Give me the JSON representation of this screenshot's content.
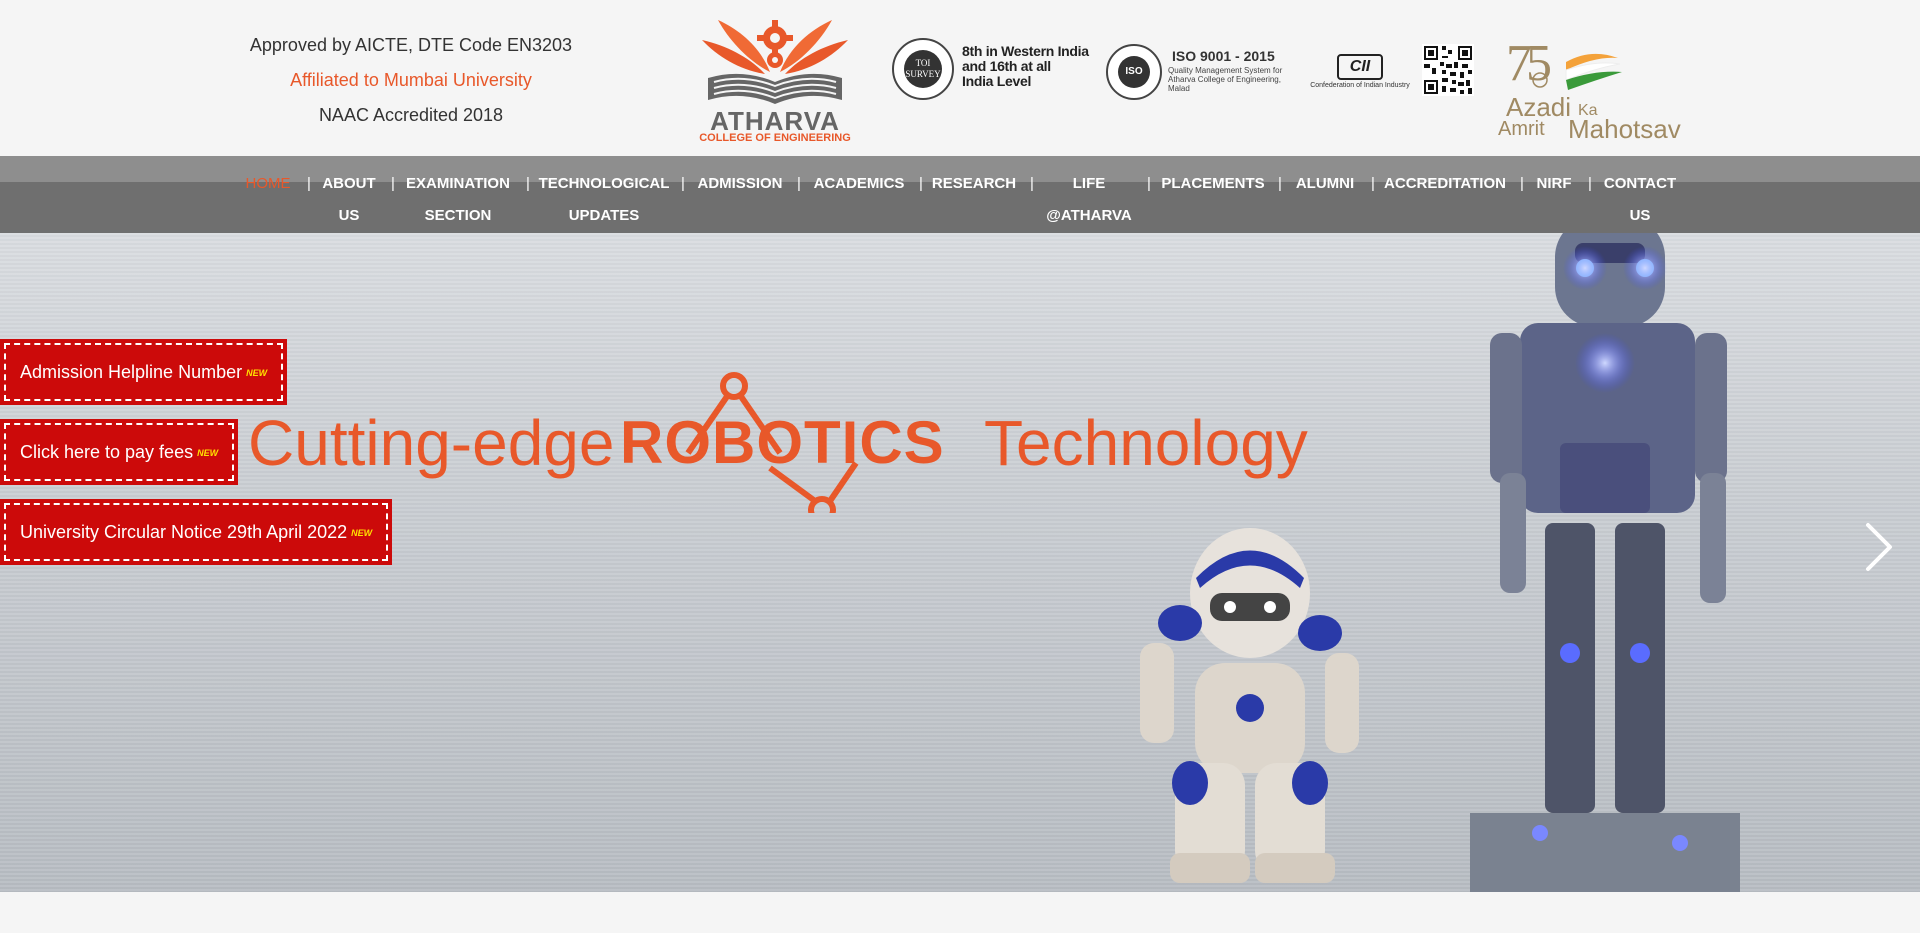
{
  "header": {
    "approval": "Approved by AICTE, DTE Code EN3203",
    "affiliation": "Affiliated to Mumbai University",
    "naac": "NAAC Accredited 2018",
    "logo_name": "ATHARVA",
    "logo_sub": "COLLEGE OF ENGINEERING",
    "toi_badge": "TOI SURVEY",
    "ranking_line1": "8th in Western India",
    "ranking_line2": "and 16th at all",
    "ranking_line3": "India Level",
    "iso_badge": "ISO",
    "iso_title": "ISO 9001 - 2015",
    "iso_desc": "Quality Management System for Atharva College of Engineering, Malad",
    "cii_mark": "CII",
    "cii_caption": "Confederation of Indian Industry",
    "azadi_num": "75",
    "azadi_w1": "Azadi",
    "azadi_w2": "Ka",
    "azadi_w3": "Amrit",
    "azadi_w4": "Mahotsav"
  },
  "nav": {
    "items": [
      {
        "label": "HOME"
      },
      {
        "label": "ABOUT US"
      },
      {
        "label": "EXAMINATION SECTION"
      },
      {
        "label": "TECHNOLOGICAL UPDATES"
      },
      {
        "label": "ADMISSION"
      },
      {
        "label": "ACADEMICS"
      },
      {
        "label": "RESEARCH"
      },
      {
        "label": "LIFE @ATHARVA"
      },
      {
        "label": "PLACEMENTS"
      },
      {
        "label": "ALUMNI"
      },
      {
        "label": "ACCREDITATION"
      },
      {
        "label": "NIRF"
      },
      {
        "label": "CONTACT US"
      }
    ],
    "separator": "|"
  },
  "hero": {
    "headline_pre": "Cutting-edge",
    "headline_main": "ROBOTICS",
    "headline_post": "Technology",
    "notices": [
      {
        "label": "Admission Helpline Number",
        "badge": "NEW"
      },
      {
        "label": "Click here to pay fees",
        "badge": "NEW"
      },
      {
        "label": "University Circular Notice 29th April 2022",
        "badge": "NEW"
      }
    ],
    "next_icon": "chevron-right-icon"
  },
  "colors": {
    "accent": "#e8582a",
    "notice_red": "#cc0a0a",
    "nav_bg": "#6f6f6f"
  }
}
